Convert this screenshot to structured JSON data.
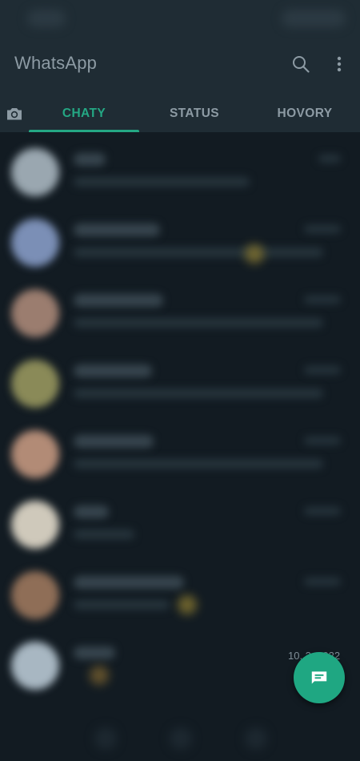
{
  "header": {
    "title": "WhatsApp",
    "search_icon": "search-icon",
    "menu_icon": "more-vert-icon"
  },
  "tabs": {
    "camera_icon": "camera-icon",
    "items": [
      {
        "label": "CHATY",
        "selected": true
      },
      {
        "label": "STATUS",
        "selected": false
      },
      {
        "label": "HOVORY",
        "selected": false
      }
    ]
  },
  "chats": {
    "last_visible_date": "10. 2. 2022"
  },
  "fab": {
    "icon": "new-chat-icon"
  },
  "colors": {
    "accent": "#24a884",
    "header_bg": "#1f2c34",
    "list_bg": "#121b22",
    "fab_bg": "#1fa782"
  }
}
